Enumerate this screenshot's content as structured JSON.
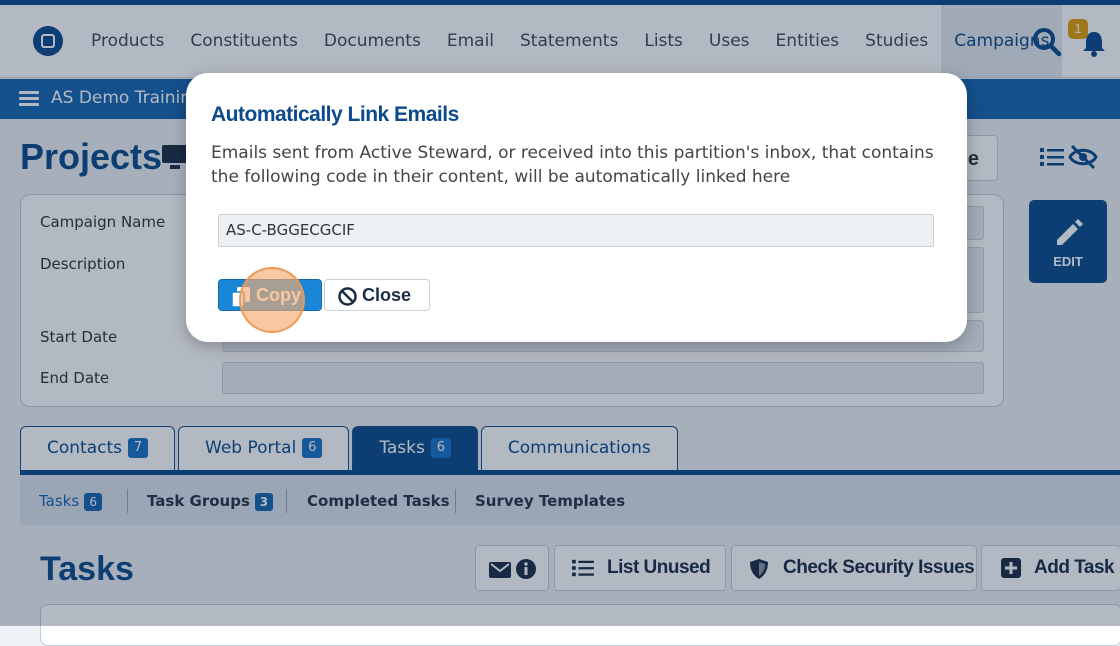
{
  "topnav": {
    "items": [
      "Products",
      "Constituents",
      "Documents",
      "Email",
      "Statements",
      "Lists",
      "Uses",
      "Entities",
      "Studies",
      "Campaigns"
    ],
    "active": "Campaigns",
    "notification_count": "1"
  },
  "subbar": {
    "title": "AS Demo Training"
  },
  "page": {
    "title": "Projects",
    "hidden_button_label": "e",
    "form_labels": {
      "campaign_name": "Campaign Name",
      "description": "Description",
      "start_date": "Start Date",
      "end_date": "End Date"
    },
    "edit_label": "EDIT"
  },
  "tabs": [
    {
      "label": "Contacts",
      "count": "7"
    },
    {
      "label": "Web Portal",
      "count": "6"
    },
    {
      "label": "Tasks",
      "count": "6"
    },
    {
      "label": "Communications",
      "count": ""
    }
  ],
  "subtabs": [
    {
      "label": "Tasks",
      "count": "6"
    },
    {
      "label": "Task Groups",
      "count": "3"
    },
    {
      "label": "Completed Tasks",
      "count": ""
    },
    {
      "label": "Survey Templates",
      "count": ""
    }
  ],
  "tasks": {
    "title": "Tasks",
    "buttons": {
      "list_unused": "List Unused",
      "check_security": "Check Security Issues",
      "add_task": "Add Task"
    }
  },
  "modal": {
    "title": "Automatically Link Emails",
    "description": "Emails sent from Active Steward, or received into this partition's inbox, that contains the following code in their content, will be automatically linked here",
    "code_value": "AS-C-BGGECGCIF",
    "copy_label": "Copy",
    "close_label": "Close"
  },
  "colors": {
    "brand": "#0b4a8b",
    "accent": "#1a86d8",
    "badge": "#e3a008"
  }
}
